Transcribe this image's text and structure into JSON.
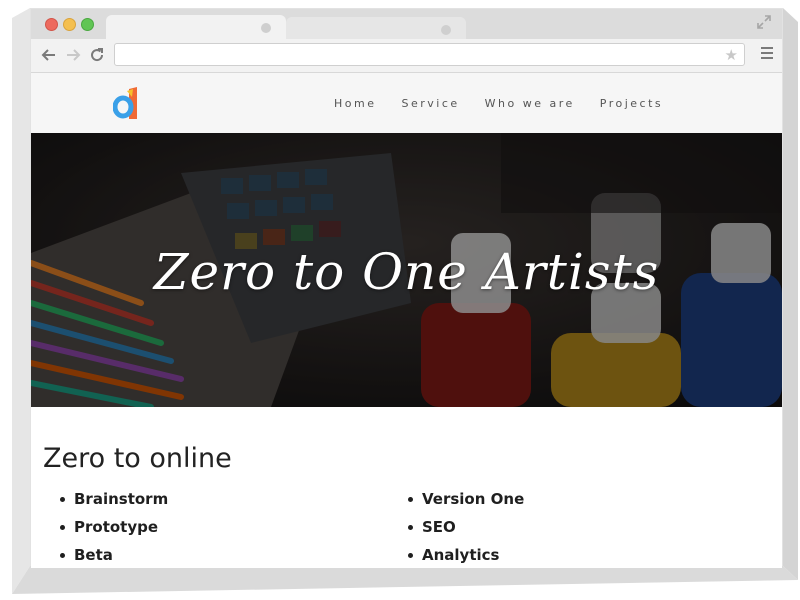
{
  "browser": {
    "address_value": "",
    "traffic_lights": [
      "#ed6a5e",
      "#f4bf4f",
      "#61c554"
    ]
  },
  "icons": {
    "back": "back-arrow-icon",
    "forward": "forward-arrow-icon",
    "reload": "reload-icon",
    "bookmark": "star-icon",
    "menu": "hamburger-menu-icon",
    "fullscreen": "expand-icon"
  },
  "site": {
    "nav": [
      {
        "label": "Home"
      },
      {
        "label": "Service"
      },
      {
        "label": "Who we are"
      },
      {
        "label": "Projects"
      }
    ],
    "hero_title": "Zero to One Artists",
    "section_heading": "Zero to online",
    "list_left": [
      "Brainstorm",
      "Prototype",
      "Beta"
    ],
    "list_right": [
      "Version One",
      "SEO",
      "Analytics"
    ],
    "logo_colors": [
      "#f06a35",
      "#3aa0e8",
      "#f5c02c"
    ]
  }
}
